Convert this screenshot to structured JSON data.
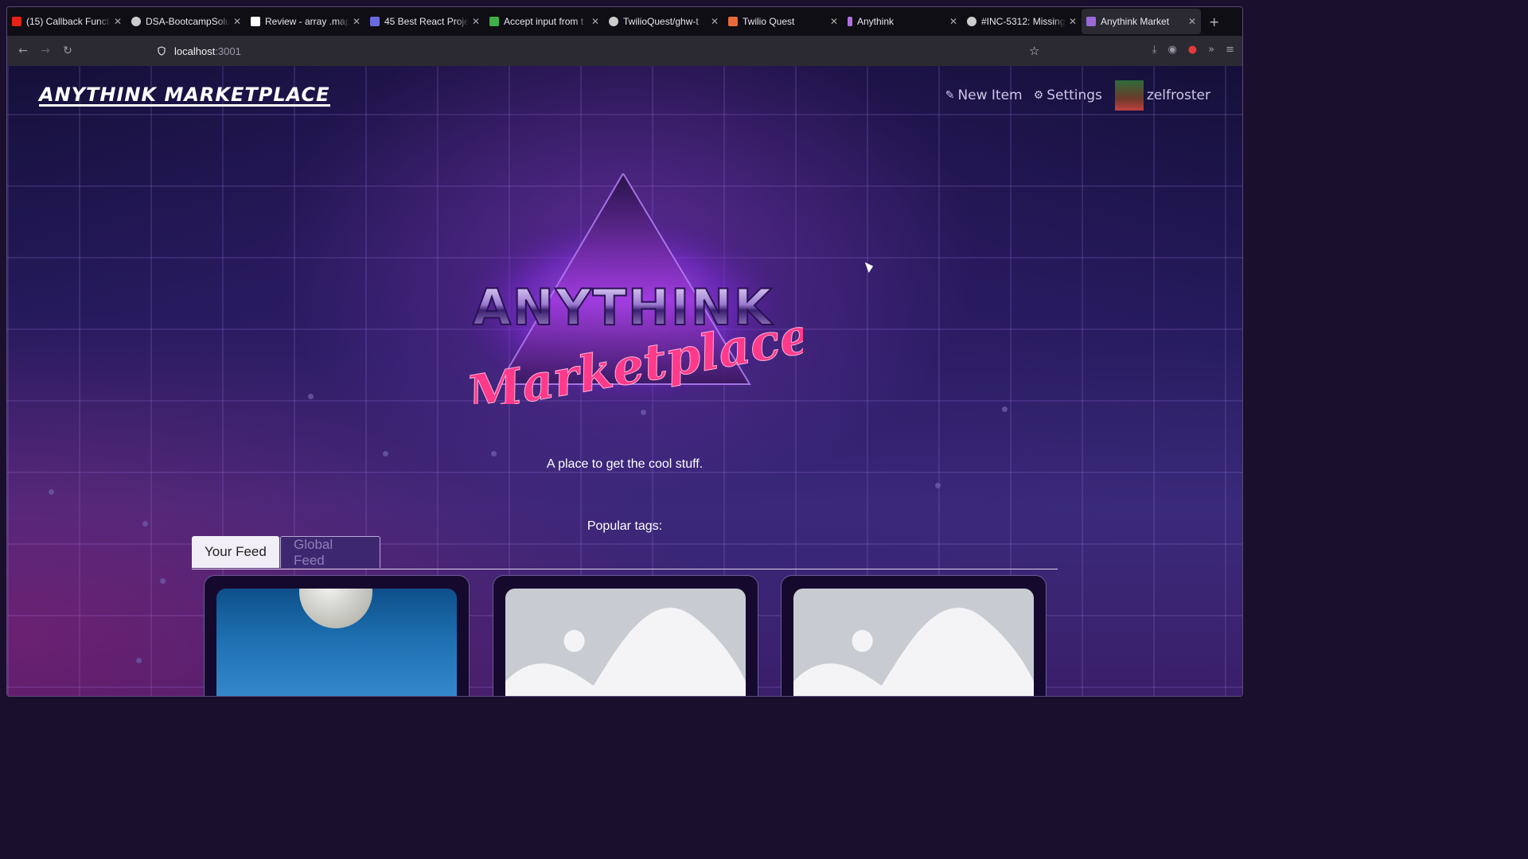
{
  "browser": {
    "tabs": [
      {
        "label": "(15) Callback Functi",
        "favicon_color": "#e62117"
      },
      {
        "label": "DSA-BootcampSolu",
        "favicon_color": "#cccccc"
      },
      {
        "label": "Review - array .map",
        "favicon_color": "#ffffff"
      },
      {
        "label": "45 Best React Proje",
        "favicon_color": "#6a6ae0"
      },
      {
        "label": "Accept input from t",
        "favicon_color": "#3fae49"
      },
      {
        "label": "TwilioQuest/ghw-t",
        "favicon_color": "#cccccc"
      },
      {
        "label": "Twilio Quest",
        "favicon_color": "#e86a3a"
      },
      {
        "label": "Anythink",
        "favicon_color": "#b070e0"
      },
      {
        "label": "#INC-5312: Missing",
        "favicon_color": "#cccccc"
      },
      {
        "label": "Anythink Market",
        "favicon_color": "#9a6ad8"
      }
    ],
    "new_tab_icon": "plus-icon",
    "url_host": "localhost",
    "url_port": ":3001"
  },
  "site": {
    "brand": "ANYTHINK MARKETPLACE",
    "nav": {
      "new_item": "New Item",
      "settings": "Settings",
      "username": "zelfroster"
    },
    "hero": {
      "logo_line1": "ANYTHINK",
      "logo_line2": "Marketplace",
      "tagline": "A place to get the cool stuff.",
      "popular_tags": "Popular tags:"
    },
    "feed_tabs": {
      "your_feed": "Your Feed",
      "global_feed": "Global Feed"
    }
  }
}
